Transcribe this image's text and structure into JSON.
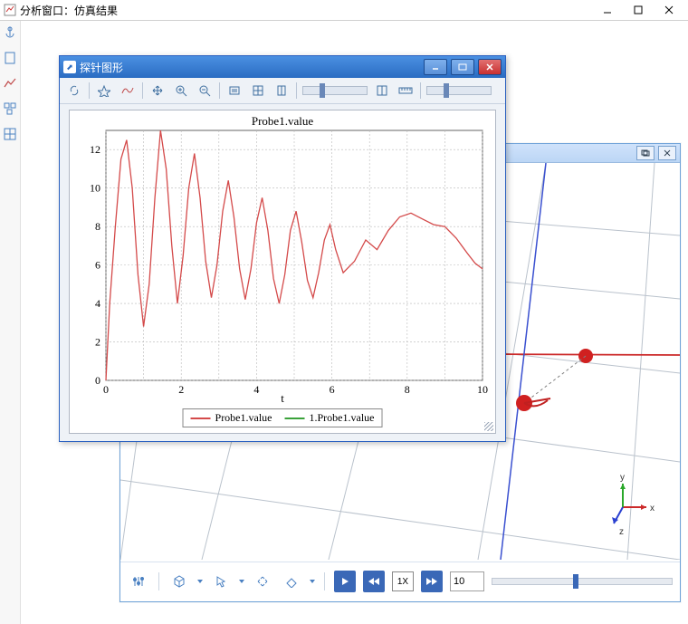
{
  "main_window": {
    "title": "分析窗口：仿真结果"
  },
  "probe_window": {
    "title": "探针图形",
    "plot_title": "Probe1.value",
    "xaxis_label": "t",
    "legend": [
      {
        "label": "Probe1.value",
        "color": "#d44a4a"
      },
      {
        "label": "1.Probe1.value",
        "color": "#3aa23a"
      }
    ]
  },
  "viewport": {
    "axes": {
      "x": "x",
      "y": "y",
      "z": "z"
    },
    "playback": {
      "speed_label": "1X",
      "frame_value": "10"
    }
  },
  "chart_data": {
    "type": "line",
    "xlabel": "t",
    "ylabel": "",
    "xlim": [
      0,
      10
    ],
    "ylim": [
      0,
      13
    ],
    "x_ticks": [
      0,
      2,
      4,
      6,
      8,
      10
    ],
    "y_ticks": [
      0,
      2,
      4,
      6,
      8,
      10,
      12
    ],
    "title": "Probe1.value",
    "series": [
      {
        "name": "Probe1.value",
        "color": "#d44a4a",
        "x": [
          0.0,
          0.1,
          0.25,
          0.4,
          0.55,
          0.7,
          0.85,
          1.0,
          1.15,
          1.3,
          1.45,
          1.6,
          1.75,
          1.9,
          2.05,
          2.2,
          2.35,
          2.5,
          2.65,
          2.8,
          2.95,
          3.1,
          3.25,
          3.4,
          3.55,
          3.7,
          3.85,
          4.0,
          4.15,
          4.3,
          4.45,
          4.6,
          4.75,
          4.9,
          5.05,
          5.2,
          5.35,
          5.5,
          5.65,
          5.8,
          5.95,
          6.1,
          6.3,
          6.6,
          6.9,
          7.2,
          7.5,
          7.8,
          8.1,
          8.4,
          8.7,
          9.0,
          9.3,
          9.6,
          9.8,
          10.0
        ],
        "y": [
          0.0,
          4.0,
          8.0,
          11.5,
          12.5,
          10.0,
          5.5,
          2.8,
          5.0,
          9.5,
          13.0,
          11.0,
          7.0,
          4.0,
          6.5,
          10.0,
          11.8,
          9.5,
          6.2,
          4.3,
          6.0,
          8.8,
          10.4,
          8.5,
          5.8,
          4.2,
          5.8,
          8.2,
          9.5,
          7.8,
          5.3,
          4.0,
          5.5,
          7.8,
          8.8,
          7.2,
          5.2,
          4.3,
          5.6,
          7.3,
          8.1,
          6.8,
          5.6,
          6.2,
          7.3,
          6.8,
          7.8,
          8.5,
          8.7,
          8.4,
          8.1,
          8.0,
          7.4,
          6.6,
          6.1,
          5.8
        ]
      }
    ]
  }
}
